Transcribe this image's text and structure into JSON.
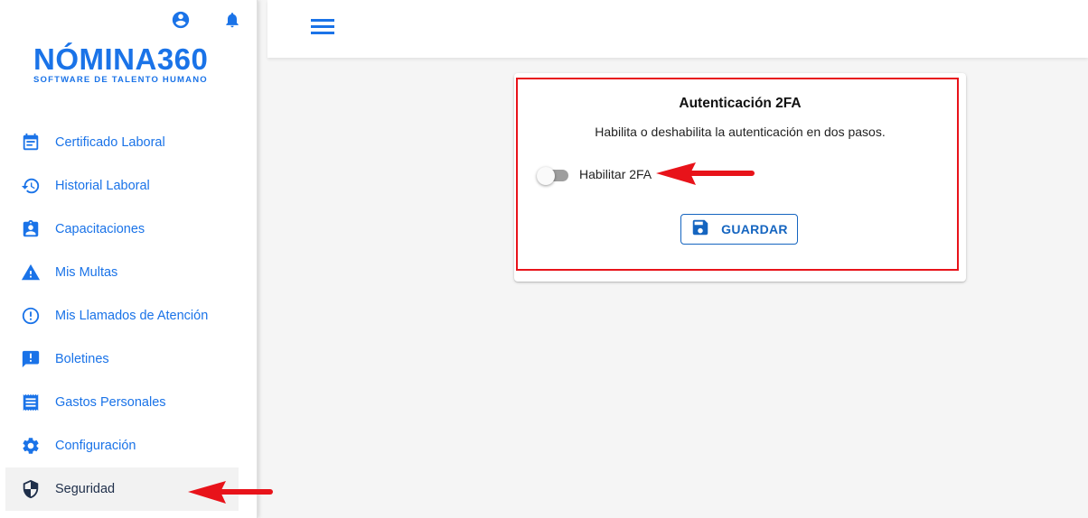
{
  "brand": {
    "name": "NÓMINA360",
    "tagline": "SOFTWARE DE TALENTO HUMANO"
  },
  "sidebar": {
    "top_icons": [
      "account-circle-icon",
      "bell-icon"
    ],
    "items": [
      {
        "label": "Certificado Laboral",
        "icon": "calendar-icon"
      },
      {
        "label": "Historial Laboral",
        "icon": "history-icon"
      },
      {
        "label": "Capacitaciones",
        "icon": "assignment-ind-icon"
      },
      {
        "label": "Mis Multas",
        "icon": "warning-icon"
      },
      {
        "label": "Mis Llamados de Atención",
        "icon": "error-outline-icon"
      },
      {
        "label": "Boletines",
        "icon": "announcement-icon"
      },
      {
        "label": "Gastos Personales",
        "icon": "receipt-icon"
      },
      {
        "label": "Configuración",
        "icon": "gear-icon"
      },
      {
        "label": "Seguridad",
        "icon": "shield-icon",
        "active": true
      }
    ]
  },
  "appbar": {
    "menu_icon": "hamburger-menu-icon"
  },
  "card": {
    "title": "Autenticación 2FA",
    "description": "Habilita o deshabilita la autenticación en dos pasos.",
    "toggle_label": "Habilitar 2FA",
    "toggle_on": false,
    "save_label": "GUARDAR",
    "save_icon": "floppy-disk-icon"
  },
  "colors": {
    "primary": "#1a73e8",
    "button": "#1565c0",
    "annotation": "#e8131a",
    "active_item_bg": "#f2f2f2"
  }
}
